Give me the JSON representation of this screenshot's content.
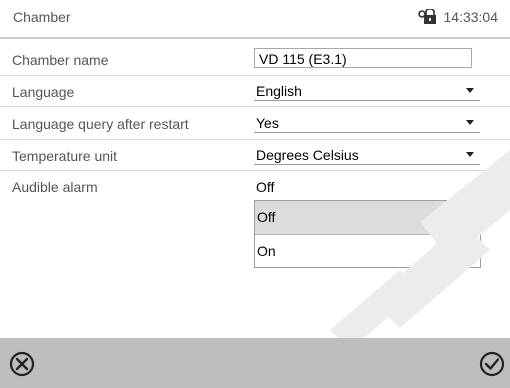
{
  "header": {
    "title": "Chamber",
    "time": "14:33:04",
    "lock_icon": "lock-icon"
  },
  "settings": {
    "chamber_name": {
      "label": "Chamber name",
      "value": "VD  115 (E3.1)"
    },
    "language": {
      "label": "Language",
      "value": "English"
    },
    "language_query": {
      "label": "Language query after restart",
      "value": "Yes"
    },
    "temperature_unit": {
      "label": "Temperature unit",
      "value": "Degrees Celsius"
    },
    "audible_alarm": {
      "label": "Audible alarm",
      "value": "Off",
      "options": [
        "Off",
        "On"
      ],
      "selected": "Off"
    }
  },
  "footer": {
    "cancel_icon": "cancel-icon",
    "confirm_icon": "confirm-icon"
  },
  "colors": {
    "footer_bg": "#bdbdbd",
    "divider": "#d6d6d6",
    "highlight": "#dcdcdc"
  }
}
